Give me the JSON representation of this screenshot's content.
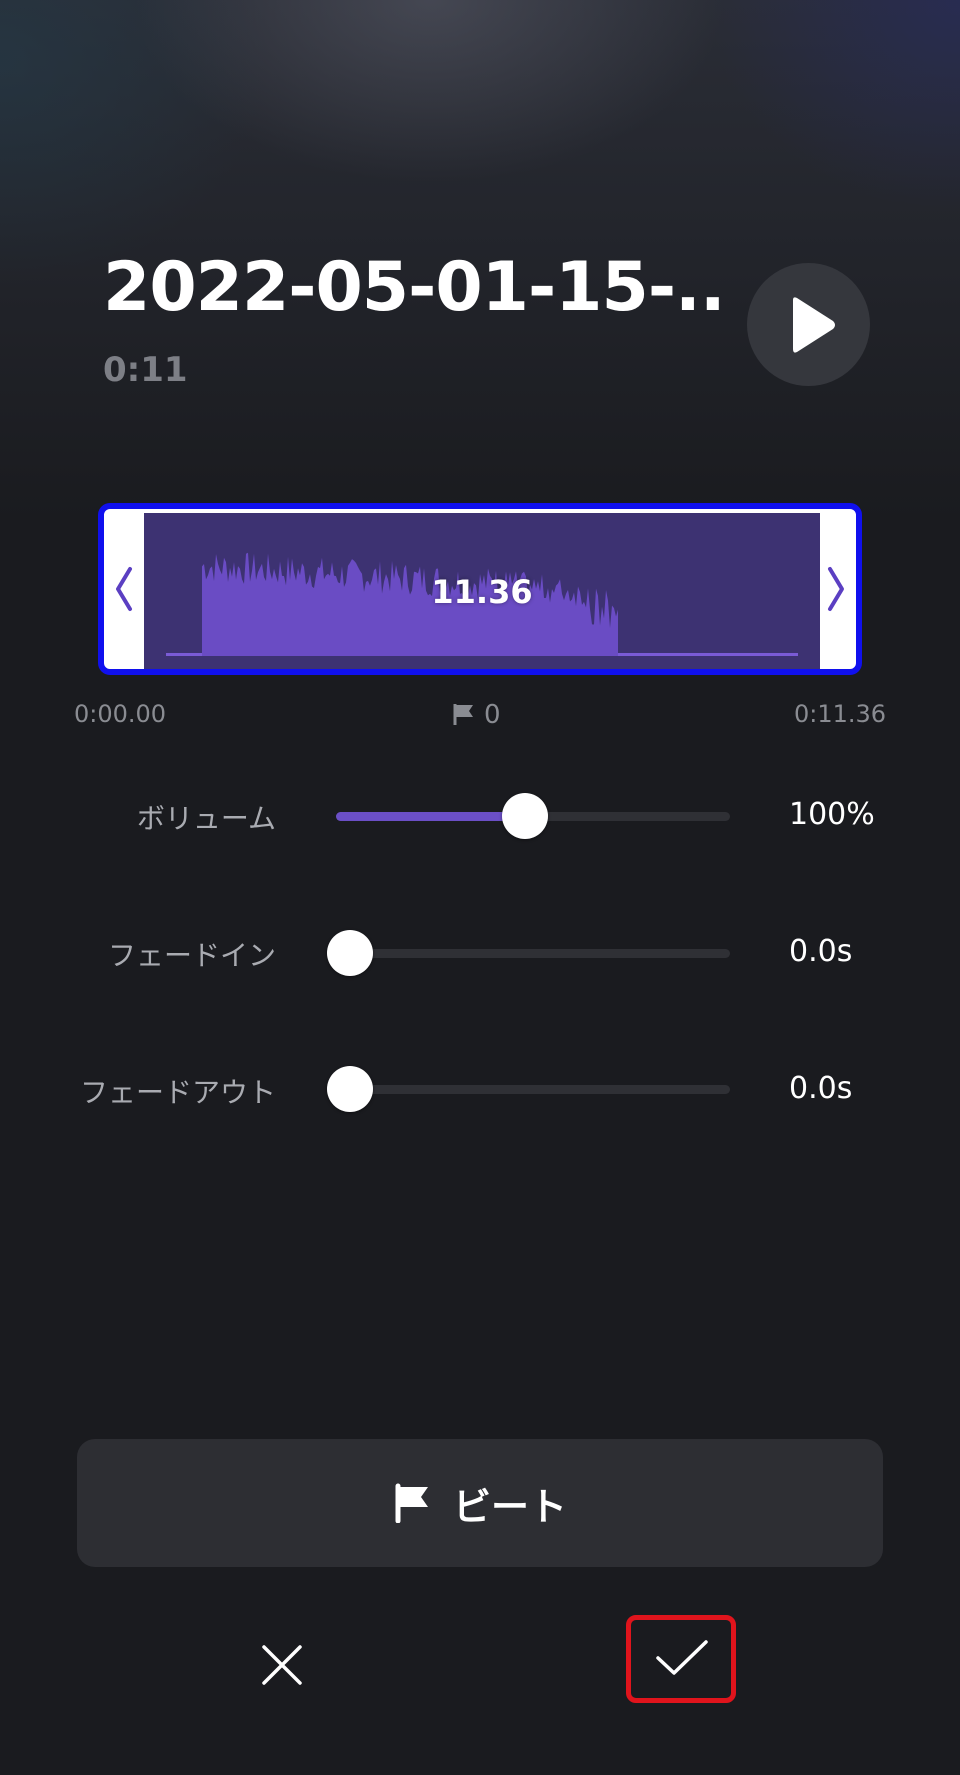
{
  "header": {
    "title": "2022-05-01-15-...",
    "duration": "0:11"
  },
  "trimmer": {
    "clip_length": "11.36",
    "start_time": "0:00.00",
    "end_time": "0:11.36",
    "beat_count": "0"
  },
  "controls": {
    "volume": {
      "label": "ボリューム",
      "value": "100%",
      "level": 0.5
    },
    "fade_in": {
      "label": "フェードイン",
      "value": "0.0s",
      "level": 0
    },
    "fade_out": {
      "label": "フェードアウト",
      "value": "0.0s",
      "level": 0
    }
  },
  "beat_button": {
    "label": "ビート",
    "icon": "flag-icon"
  },
  "footer": {
    "cancel_icon": "close-icon",
    "confirm_icon": "check-icon"
  },
  "colors": {
    "accent": "#6b4fc6",
    "selection_border": "#1010ee",
    "highlight_box": "#e0141c"
  }
}
